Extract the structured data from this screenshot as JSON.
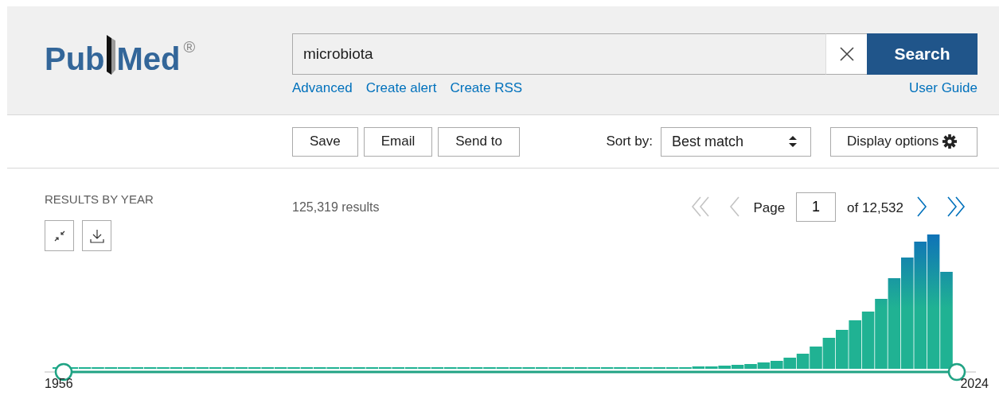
{
  "logo": {
    "text_left": "Pub",
    "text_right": "Med",
    "registered": "®"
  },
  "search": {
    "value": "microbiota",
    "button": "Search",
    "links": [
      "Advanced",
      "Create alert",
      "Create RSS"
    ],
    "user_guide": "User Guide"
  },
  "toolbar": {
    "buttons": [
      "Save",
      "Email",
      "Send to"
    ],
    "sort_label": "Sort by:",
    "sort_value": "Best match",
    "display_options": "Display options"
  },
  "results": {
    "heading": "RESULTS BY YEAR",
    "count": "125,319 results",
    "start_year": "1956",
    "end_year": "2024",
    "range_handles": [
      {
        "level": 0
      },
      {
        "level": 1
      }
    ]
  },
  "pagination": {
    "page_label": "Page",
    "page": "1",
    "of": "of 12,532",
    "first_disabled": true,
    "prev_disabled": true,
    "next_disabled": false,
    "last_disabled": false
  }
}
